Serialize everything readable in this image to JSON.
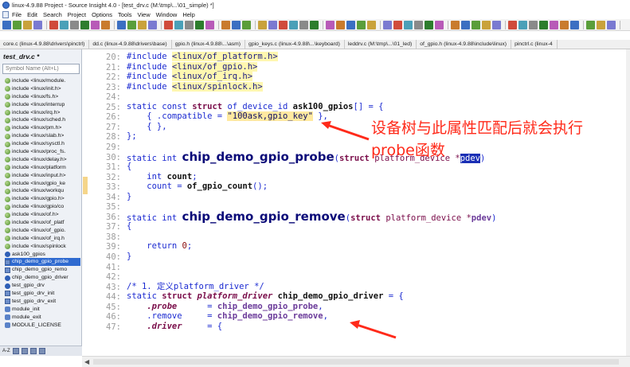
{
  "window": {
    "title": "linux-4.9.88 Project - Source Insight 4.0 - [test_drv.c (M:\\tmp\\...\\01_simple) *]"
  },
  "menu": {
    "items": [
      "File",
      "Edit",
      "Search",
      "Project",
      "Options",
      "Tools",
      "View",
      "Window",
      "Help"
    ]
  },
  "file_tabs": [
    "core.c (linux-4.9.88\\drivers\\pinctrl)",
    "dd.c (linux-4.9.88\\drivers\\base)",
    "gpio.h (linux-4.9.88\\...\\asm)",
    "gpio_keys.c (linux-4.9.88\\...\\keyboard)",
    "leddrv.c (M:\\tmp\\...\\01_led)",
    "of_gpio.h (linux-4.9.88\\include\\linux)",
    "pinctrl.c (linux-4"
  ],
  "sidebar": {
    "file_title": "test_drv.c *",
    "search_placeholder": "Symbol Name (Alt+L)",
    "items": [
      {
        "label": "include <linux/module.",
        "icon": "include-icon"
      },
      {
        "label": "include <linux/init.h>",
        "icon": "include-icon"
      },
      {
        "label": "include <linux/fs.h>",
        "icon": "include-icon"
      },
      {
        "label": "include <linux/interrup",
        "icon": "include-icon"
      },
      {
        "label": "include <linux/irq.h>",
        "icon": "include-icon"
      },
      {
        "label": "include <linux/sched.h",
        "icon": "include-icon"
      },
      {
        "label": "include <linux/pm.h>",
        "icon": "include-icon"
      },
      {
        "label": "include <linux/slab.h>",
        "icon": "include-icon"
      },
      {
        "label": "include <linux/sysctl.h",
        "icon": "include-icon"
      },
      {
        "label": "include <linux/proc_fs.",
        "icon": "include-icon"
      },
      {
        "label": "include <linux/delay.h>",
        "icon": "include-icon"
      },
      {
        "label": "include <linux/platform",
        "icon": "include-icon"
      },
      {
        "label": "include <linux/input.h>",
        "icon": "include-icon"
      },
      {
        "label": "include <linux/gpio_ke",
        "icon": "include-icon"
      },
      {
        "label": "include <linux/workqu",
        "icon": "include-icon"
      },
      {
        "label": "include <linux/gpio.h>",
        "icon": "include-icon"
      },
      {
        "label": "include <linux/gpio/co",
        "icon": "include-icon"
      },
      {
        "label": "include <linux/of.h>",
        "icon": "include-icon"
      },
      {
        "label": "include <linux/of_platf",
        "icon": "include-icon"
      },
      {
        "label": "include <linux/of_gpio.",
        "icon": "include-icon"
      },
      {
        "label": "include <linux/of_irq.h",
        "icon": "include-icon"
      },
      {
        "label": "include <linux/spinlock",
        "icon": "include-icon"
      },
      {
        "label": "ask100_gpios",
        "icon": "symbol-icon"
      },
      {
        "label": "chip_demo_gpio_probe",
        "icon": "function-icon"
      },
      {
        "label": "chip_demo_gpio_remo",
        "icon": "function-icon"
      },
      {
        "label": "chip_demo_gpio_driver",
        "icon": "symbol-icon"
      },
      {
        "label": "test_gpio_drv",
        "icon": "symbol-icon"
      },
      {
        "label": "test_gpio_drv_init",
        "icon": "function-icon"
      },
      {
        "label": "test_gpio_drv_exit",
        "icon": "function-icon"
      },
      {
        "label": "module_init",
        "icon": "macro-icon"
      },
      {
        "label": "module_exit",
        "icon": "macro-icon"
      },
      {
        "label": "MODULE_LICENSE",
        "icon": "macro-icon"
      }
    ],
    "selected_index": 23,
    "footer_label": "A-Z"
  },
  "editor": {
    "lines": [
      {
        "n": "20:",
        "segments": [
          {
            "c": "inc",
            "t": "#include "
          },
          {
            "c": "path",
            "t": "<linux/of_platform.h>"
          }
        ]
      },
      {
        "n": "21:",
        "segments": [
          {
            "c": "inc",
            "t": "#include "
          },
          {
            "c": "path",
            "t": "<linux/of_gpio.h>"
          }
        ]
      },
      {
        "n": "22:",
        "segments": [
          {
            "c": "inc",
            "t": "#include "
          },
          {
            "c": "path",
            "t": "<linux/of_irq.h>"
          }
        ]
      },
      {
        "n": "23:",
        "segments": [
          {
            "c": "inc",
            "t": "#include "
          },
          {
            "c": "path",
            "t": "<linux/spinlock.h>"
          }
        ]
      },
      {
        "n": "24:",
        "segments": []
      },
      {
        "n": "25:",
        "segments": [
          {
            "c": "kw",
            "t": "static const "
          },
          {
            "c": "struct",
            "t": "struct"
          },
          {
            "c": "kw",
            "t": " of_device_id "
          },
          {
            "c": "bold",
            "t": "ask100_gpios"
          },
          {
            "c": "kw",
            "t": "[] = {"
          }
        ]
      },
      {
        "n": "26:",
        "segments": [
          {
            "c": "kw",
            "t": "    { .compatible = "
          },
          {
            "c": "str",
            "t": "\"100ask,gpio_key\""
          },
          {
            "c": "kw",
            "t": " },"
          }
        ]
      },
      {
        "n": "27:",
        "segments": [
          {
            "c": "kw",
            "t": "    { },"
          }
        ]
      },
      {
        "n": "28:",
        "segments": [
          {
            "c": "kw",
            "t": "};"
          }
        ]
      },
      {
        "n": "29:",
        "segments": []
      },
      {
        "n": "30:",
        "segments": [
          {
            "c": "kw",
            "t": "static int "
          },
          {
            "c": "fnbig",
            "t": "chip_demo_gpio_probe"
          },
          {
            "c": "kw",
            "t": "("
          },
          {
            "c": "struct",
            "t": "struct"
          },
          {
            "c": "param",
            "t": " platform_device *"
          },
          {
            "c": "pdevsel",
            "t": "pdev"
          },
          {
            "c": "kw",
            "t": ")"
          }
        ]
      },
      {
        "n": "31:",
        "segments": [
          {
            "c": "kw",
            "t": "{"
          }
        ]
      },
      {
        "n": "32:",
        "segments": [
          {
            "c": "kw",
            "t": "    int "
          },
          {
            "c": "bold",
            "t": "count"
          },
          {
            "c": "kw",
            "t": ";"
          }
        ]
      },
      {
        "n": "33:",
        "segments": [
          {
            "c": "kw",
            "t": "    count = "
          },
          {
            "c": "bold",
            "t": "of_gpio_count"
          },
          {
            "c": "kw",
            "t": "();"
          }
        ]
      },
      {
        "n": "34:",
        "segments": [
          {
            "c": "kw",
            "t": "}"
          }
        ]
      },
      {
        "n": "35:",
        "segments": []
      },
      {
        "n": "36:",
        "segments": [
          {
            "c": "kw",
            "t": "static int "
          },
          {
            "c": "fnbig",
            "t": "chip_demo_gpio_remove"
          },
          {
            "c": "kw",
            "t": "("
          },
          {
            "c": "struct",
            "t": "struct"
          },
          {
            "c": "param",
            "t": " platform_device *"
          },
          {
            "c": "var",
            "t": "pdev"
          },
          {
            "c": "kw",
            "t": ")"
          }
        ]
      },
      {
        "n": "37:",
        "segments": [
          {
            "c": "kw",
            "t": "{"
          }
        ]
      },
      {
        "n": "38:",
        "segments": []
      },
      {
        "n": "39:",
        "segments": [
          {
            "c": "kw",
            "t": "    return "
          },
          {
            "c": "num",
            "t": "0"
          },
          {
            "c": "kw",
            "t": ";"
          }
        ]
      },
      {
        "n": "40:",
        "segments": [
          {
            "c": "kw",
            "t": "}"
          }
        ]
      },
      {
        "n": "41:",
        "segments": []
      },
      {
        "n": "42:",
        "segments": []
      },
      {
        "n": "43:",
        "segments": [
          {
            "c": "cmt",
            "t": "/* 1. 定义platform_driver */"
          }
        ]
      },
      {
        "n": "44:",
        "segments": [
          {
            "c": "kw",
            "t": "static "
          },
          {
            "c": "struct",
            "t": "struct"
          },
          {
            "c": "field",
            "t": " platform_driver"
          },
          {
            "c": "bold",
            "t": " chip_demo_gpio_driver"
          },
          {
            "c": "kw",
            "t": " = {"
          }
        ]
      },
      {
        "n": "45:",
        "segments": [
          {
            "c": "field",
            "t": "    .probe      "
          },
          {
            "c": "kw",
            "t": "= "
          },
          {
            "c": "var",
            "t": "chip_demo_gpio_probe"
          },
          {
            "c": "kw",
            "t": ","
          }
        ]
      },
      {
        "n": "46:",
        "segments": [
          {
            "c": "kw",
            "t": "    .remove     = "
          },
          {
            "c": "var",
            "t": "chip_demo_gpio_remove"
          },
          {
            "c": "kw",
            "t": ","
          }
        ]
      },
      {
        "n": "47:",
        "segments": [
          {
            "c": "field",
            "t": "    .driver     "
          },
          {
            "c": "kw",
            "t": "= {"
          }
        ]
      }
    ]
  },
  "annotation": {
    "line1": "设备树与此属性匹配后就会执行",
    "line2": "probe函数",
    "color": "#ff2a1a"
  },
  "colors": {
    "keyword": "#1b2ad1",
    "selection": "#2f6ad0",
    "string_highlight": "#ffe9a0"
  }
}
